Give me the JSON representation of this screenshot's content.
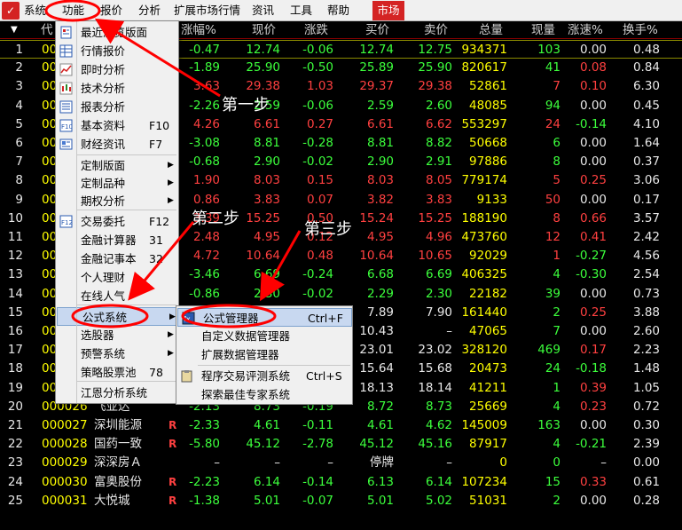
{
  "menubar": {
    "items": [
      "系统",
      "功能",
      "报价",
      "分析",
      "扩展市场行情",
      "资讯",
      "工具",
      "帮助"
    ],
    "market_tab": "市场"
  },
  "table": {
    "headers": [
      "代",
      "涨幅%",
      "现价",
      "涨跌",
      "买价",
      "卖价",
      "总量",
      "现量",
      "涨速%",
      "换手%"
    ],
    "rows": [
      {
        "n": "1",
        "code": "00",
        "name": "",
        "flag": "",
        "pct": "-0.47",
        "price": "12.74",
        "chg": "-0.06",
        "bid": "12.74",
        "ask": "12.75",
        "vol": "934371",
        "cur": "103",
        "spd": "0.00",
        "turn": "0.48"
      },
      {
        "n": "2",
        "code": "00",
        "name": "",
        "flag": "",
        "pct": "-1.89",
        "price": "25.90",
        "chg": "-0.50",
        "bid": "25.89",
        "ask": "25.90",
        "vol": "820617",
        "cur": "41",
        "spd": "0.08",
        "turn": "0.84"
      },
      {
        "n": "3",
        "code": "00",
        "name": "",
        "flag": "",
        "pct": "3.63",
        "price": "29.38",
        "chg": "1.03",
        "bid": "29.37",
        "ask": "29.38",
        "vol": "52861",
        "cur": "7",
        "spd": "0.10",
        "turn": "6.30"
      },
      {
        "n": "4",
        "code": "00",
        "name": "",
        "flag": "",
        "pct": "-2.26",
        "price": "2.59",
        "chg": "-0.06",
        "bid": "2.59",
        "ask": "2.60",
        "vol": "48085",
        "cur": "94",
        "spd": "0.00",
        "turn": "0.45"
      },
      {
        "n": "5",
        "code": "00",
        "name": "",
        "flag": "",
        "pct": "4.26",
        "price": "6.61",
        "chg": "0.27",
        "bid": "6.61",
        "ask": "6.62",
        "vol": "553297",
        "cur": "24",
        "spd": "-0.14",
        "turn": "4.10"
      },
      {
        "n": "6",
        "code": "00",
        "name": "",
        "flag": "",
        "pct": "-3.08",
        "price": "8.81",
        "chg": "-0.28",
        "bid": "8.81",
        "ask": "8.82",
        "vol": "50668",
        "cur": "6",
        "spd": "0.00",
        "turn": "1.64"
      },
      {
        "n": "7",
        "code": "00",
        "name": "",
        "flag": "",
        "pct": "-0.68",
        "price": "2.90",
        "chg": "-0.02",
        "bid": "2.90",
        "ask": "2.91",
        "vol": "97886",
        "cur": "8",
        "spd": "0.00",
        "turn": "0.37"
      },
      {
        "n": "8",
        "code": "00",
        "name": "",
        "flag": "",
        "pct": "1.90",
        "price": "8.03",
        "chg": "0.15",
        "bid": "8.03",
        "ask": "8.05",
        "vol": "779174",
        "cur": "5",
        "spd": "0.25",
        "turn": "3.06"
      },
      {
        "n": "9",
        "code": "00",
        "name": "",
        "flag": "",
        "pct": "0.86",
        "price": "3.83",
        "chg": "0.07",
        "bid": "3.82",
        "ask": "3.83",
        "vol": "9133",
        "cur": "50",
        "spd": "0.00",
        "turn": "0.17"
      },
      {
        "n": "10",
        "code": "00",
        "name": "",
        "flag": "",
        "pct": "3.39",
        "price": "15.25",
        "chg": "0.50",
        "bid": "15.24",
        "ask": "15.25",
        "vol": "188190",
        "cur": "8",
        "spd": "0.66",
        "turn": "3.57"
      },
      {
        "n": "11",
        "code": "00",
        "name": "",
        "flag": "",
        "pct": "2.48",
        "price": "4.95",
        "chg": "0.12",
        "bid": "4.95",
        "ask": "4.96",
        "vol": "473760",
        "cur": "12",
        "spd": "0.41",
        "turn": "2.42"
      },
      {
        "n": "12",
        "code": "00",
        "name": "",
        "flag": "",
        "pct": "4.72",
        "price": "10.64",
        "chg": "0.48",
        "bid": "10.64",
        "ask": "10.65",
        "vol": "92029",
        "cur": "1",
        "spd": "-0.27",
        "turn": "4.56"
      },
      {
        "n": "13",
        "code": "00",
        "name": "",
        "flag": "",
        "pct": "-3.46",
        "price": "6.69",
        "chg": "-0.24",
        "bid": "6.68",
        "ask": "6.69",
        "vol": "406325",
        "cur": "4",
        "spd": "-0.30",
        "turn": "2.54"
      },
      {
        "n": "14",
        "code": "00",
        "name": "",
        "flag": "",
        "pct": "-0.86",
        "price": "2.30",
        "chg": "-0.02",
        "bid": "2.29",
        "ask": "2.30",
        "vol": "22182",
        "cur": "39",
        "spd": "0.00",
        "turn": "0.73"
      },
      {
        "n": "15",
        "code": "00",
        "name": "",
        "flag": "",
        "pct": "",
        "price": "",
        "chg": "",
        "bid": "7.89",
        "ask": "7.90",
        "vol": "161440",
        "cur": "2",
        "spd": "0.25",
        "turn": "3.88"
      },
      {
        "n": "16",
        "code": "00",
        "name": "",
        "flag": "",
        "pct": "",
        "price": "",
        "chg": "",
        "bid": "10.43",
        "ask": "–",
        "vol": "47065",
        "cur": "7",
        "spd": "0.00",
        "turn": "2.60"
      },
      {
        "n": "17",
        "code": "00",
        "name": "",
        "flag": "",
        "pct": "",
        "price": "",
        "chg": "",
        "bid": "23.01",
        "ask": "23.02",
        "vol": "328120",
        "cur": "469",
        "spd": "0.17",
        "turn": "2.23"
      },
      {
        "n": "18",
        "code": "00",
        "name": "",
        "flag": "",
        "pct": "",
        "price": "",
        "chg": "",
        "bid": "15.64",
        "ask": "15.68",
        "vol": "20473",
        "cur": "24",
        "spd": "-0.18",
        "turn": "1.48"
      },
      {
        "n": "19",
        "code": "00",
        "name": "",
        "flag": "",
        "pct": "",
        "price": "",
        "chg": "",
        "bid": "18.13",
        "ask": "18.14",
        "vol": "41211",
        "cur": "1",
        "spd": "0.39",
        "turn": "1.05"
      },
      {
        "n": "20",
        "code": "000026",
        "name": "飞亚达",
        "flag": "",
        "pct": "-2.13",
        "price": "8.73",
        "chg": "-0.19",
        "bid": "8.72",
        "ask": "8.73",
        "vol": "25669",
        "cur": "4",
        "spd": "0.23",
        "turn": "0.72"
      },
      {
        "n": "21",
        "code": "000027",
        "name": "深圳能源",
        "flag": "R",
        "pct": "-2.33",
        "price": "4.61",
        "chg": "-0.11",
        "bid": "4.61",
        "ask": "4.62",
        "vol": "145009",
        "cur": "163",
        "spd": "0.00",
        "turn": "0.30"
      },
      {
        "n": "22",
        "code": "000028",
        "name": "国药一致",
        "flag": "R",
        "pct": "-5.80",
        "price": "45.12",
        "chg": "-2.78",
        "bid": "45.12",
        "ask": "45.16",
        "vol": "87917",
        "cur": "4",
        "spd": "-0.21",
        "turn": "2.39"
      },
      {
        "n": "23",
        "code": "000029",
        "name": "深深房Ａ",
        "flag": "",
        "pct": "–",
        "price": "–",
        "chg": "–",
        "bid": "停牌",
        "ask": "–",
        "vol": "0",
        "cur": "0",
        "spd": "–",
        "turn": "0.00"
      },
      {
        "n": "24",
        "code": "000030",
        "name": "富奥股份",
        "flag": "R",
        "pct": "-2.23",
        "price": "6.14",
        "chg": "-0.14",
        "bid": "6.13",
        "ask": "6.14",
        "vol": "107234",
        "cur": "15",
        "spd": "0.33",
        "turn": "0.61"
      },
      {
        "n": "25",
        "code": "000031",
        "name": "大悦城",
        "flag": "R",
        "pct": "-1.38",
        "price": "5.01",
        "chg": "-0.07",
        "bid": "5.01",
        "ask": "5.02",
        "vol": "51031",
        "cur": "2",
        "spd": "0.00",
        "turn": "0.28"
      }
    ]
  },
  "func_menu": {
    "items": [
      {
        "label": "最近浏览版面",
        "shortcut": "",
        "arrow": false,
        "icon": "doc-icon"
      },
      {
        "label": "行情报价",
        "shortcut": "",
        "arrow": false,
        "icon": "grid-icon"
      },
      {
        "label": "即时分析",
        "shortcut": "",
        "arrow": false,
        "icon": "line-chart-icon"
      },
      {
        "label": "技术分析",
        "shortcut": "",
        "arrow": false,
        "icon": "candle-icon"
      },
      {
        "label": "报表分析",
        "shortcut": "",
        "arrow": false,
        "icon": "report-icon"
      },
      {
        "label": "基本资料",
        "shortcut": "F10",
        "arrow": false,
        "icon": "f10-icon"
      },
      {
        "label": "财经资讯",
        "shortcut": "F7",
        "arrow": false,
        "icon": "news-icon"
      },
      {
        "label": "定制版面",
        "shortcut": "",
        "arrow": true,
        "icon": ""
      },
      {
        "label": "定制品种",
        "shortcut": "",
        "arrow": true,
        "icon": ""
      },
      {
        "label": "期权分析",
        "shortcut": "",
        "arrow": true,
        "icon": ""
      },
      {
        "label": "交易委托",
        "shortcut": "F12",
        "arrow": false,
        "icon": "f12-icon"
      },
      {
        "label": "金融计算器",
        "shortcut": "31",
        "arrow": false,
        "icon": ""
      },
      {
        "label": "金融记事本",
        "shortcut": "32",
        "arrow": false,
        "icon": ""
      },
      {
        "label": "个人理财",
        "shortcut": "",
        "arrow": false,
        "icon": ""
      },
      {
        "label": "在线人气",
        "shortcut": "",
        "arrow": false,
        "icon": ""
      },
      {
        "label": "公式系统",
        "shortcut": "",
        "arrow": true,
        "icon": ""
      },
      {
        "label": "选股器",
        "shortcut": "",
        "arrow": true,
        "icon": ""
      },
      {
        "label": "预警系统",
        "shortcut": "",
        "arrow": true,
        "icon": ""
      },
      {
        "label": "策略股票池",
        "shortcut": "78",
        "arrow": false,
        "icon": ""
      },
      {
        "label": "江恩分析系统",
        "shortcut": "",
        "arrow": false,
        "icon": ""
      }
    ]
  },
  "formula_submenu": {
    "items": [
      {
        "label": "公式管理器",
        "shortcut": "Ctrl+F",
        "icon": "formula-icon"
      },
      {
        "label": "自定义数据管理器",
        "shortcut": "",
        "icon": ""
      },
      {
        "label": "扩展数据管理器",
        "shortcut": "",
        "icon": ""
      },
      {
        "label": "程序交易评测系统",
        "shortcut": "Ctrl+S",
        "icon": "clipboard-icon"
      },
      {
        "label": "探索最佳专家系统",
        "shortcut": "",
        "icon": ""
      }
    ]
  },
  "annotations": {
    "step1": "第一步",
    "step2": "第二步",
    "step3": "第三步"
  },
  "colors": {
    "highlight": "#ff0000",
    "up": "#ff4040",
    "down": "#3cff3c",
    "code": "#ffff00"
  }
}
